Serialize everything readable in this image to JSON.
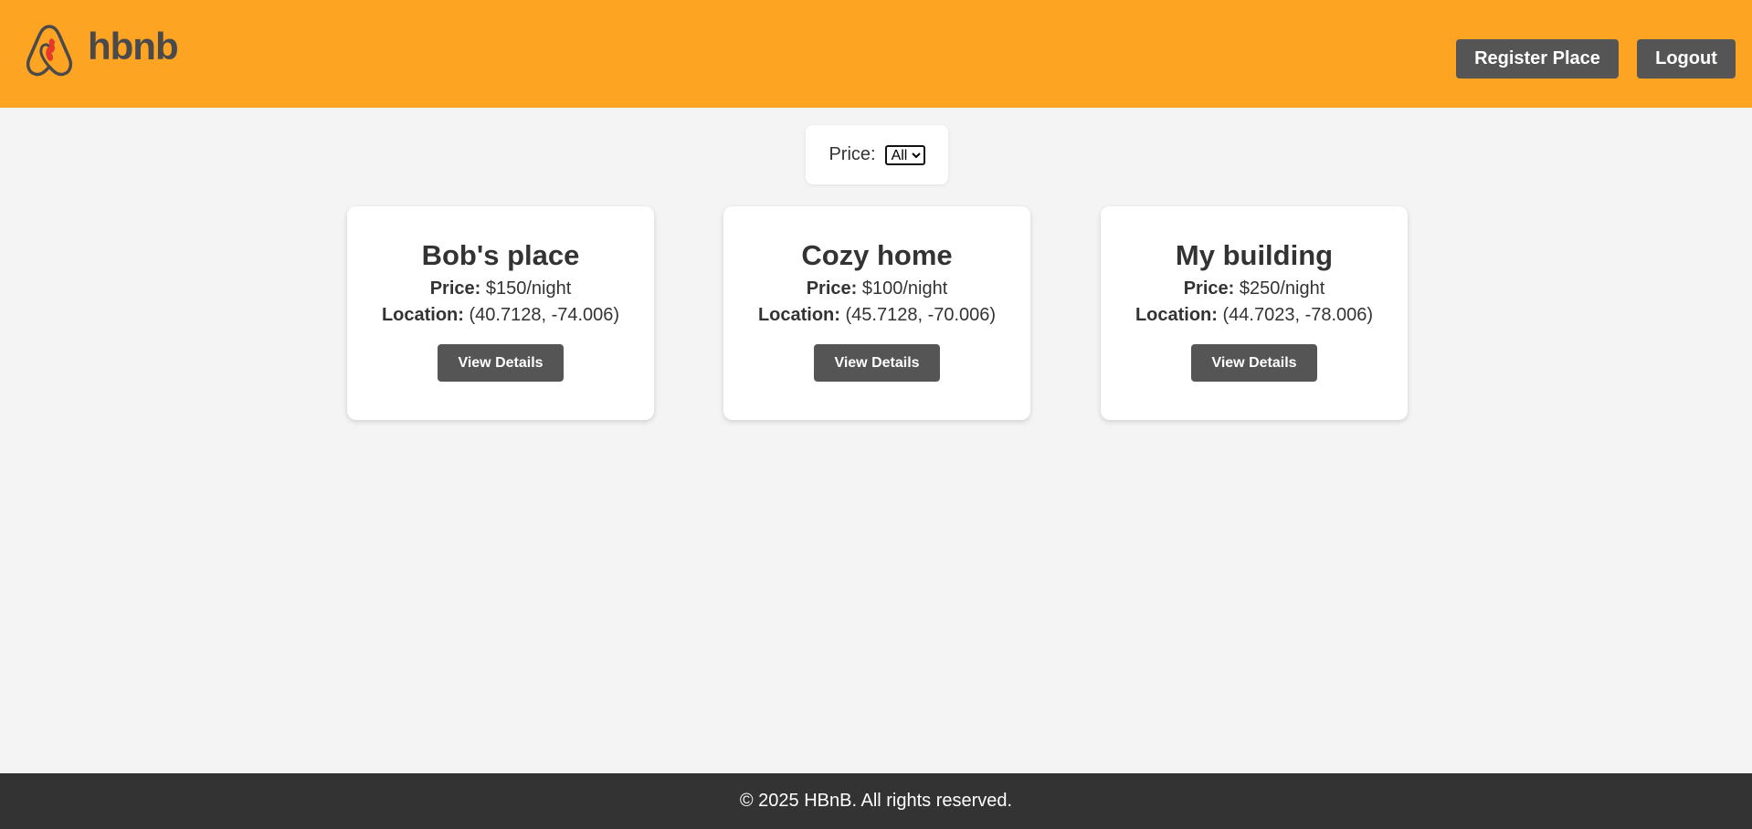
{
  "brand": {
    "logo_text": "hbnb",
    "colors": {
      "header": "#fea423",
      "button": "#555555",
      "footer": "#333333",
      "background": "#f4f4f4"
    }
  },
  "header": {
    "register_label": "Register Place",
    "logout_label": "Logout"
  },
  "filter": {
    "label": "Price:",
    "selected": "All"
  },
  "places": [
    {
      "name": "Bob's place",
      "price_label": "Price:",
      "price": "$150/night",
      "location_label": "Location:",
      "location": "(40.7128, -74.006)",
      "button": "View Details"
    },
    {
      "name": "Cozy home",
      "price_label": "Price:",
      "price": "$100/night",
      "location_label": "Location:",
      "location": "(45.7128, -70.006)",
      "button": "View Details"
    },
    {
      "name": "My building",
      "price_label": "Price:",
      "price": "$250/night",
      "location_label": "Location:",
      "location": "(44.7023, -78.006)",
      "button": "View Details"
    }
  ],
  "footer": {
    "text": "© 2025 HBnB. All rights reserved."
  }
}
